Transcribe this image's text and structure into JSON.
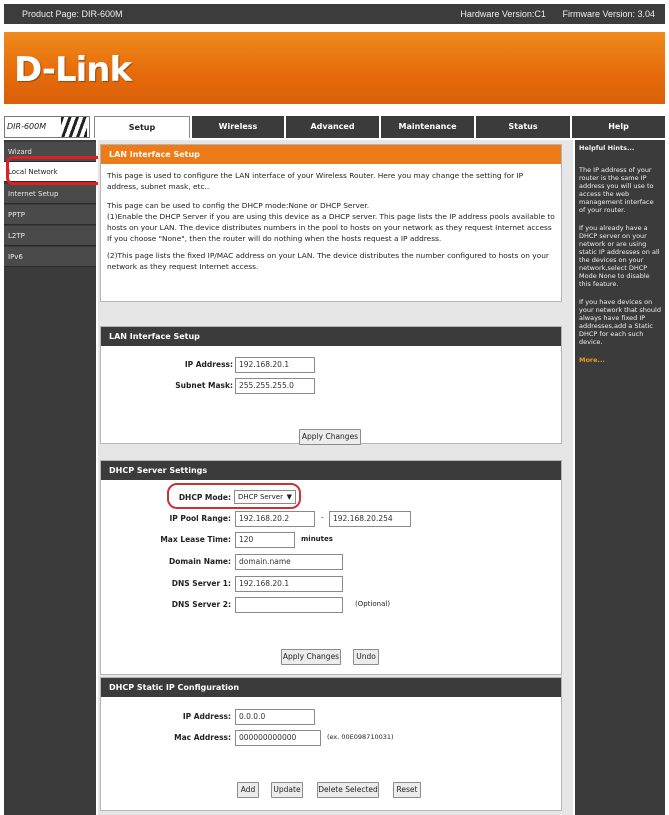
{
  "header": {
    "product_page": "Product Page: DIR-600M",
    "hardware_version": "Hardware Version:C1",
    "firmware_version": "Firmware Version: 3.04"
  },
  "brand": {
    "logo_text": "D-Link",
    "model_badge": "DIR-600M"
  },
  "nav": {
    "tabs": [
      "Setup",
      "Wireless",
      "Advanced",
      "Maintenance",
      "Status",
      "Help"
    ],
    "active_tab": "Setup"
  },
  "sidebar": {
    "items": [
      "Wizard",
      "Local Network",
      "Internet Setup",
      "PPTP",
      "L2TP",
      "IPv6"
    ],
    "active_item": "Local Network"
  },
  "help": {
    "title": "Helpful Hints...",
    "p1": "The IP address of your router is the same IP address you will use to access the web management interface of your router.",
    "p2": "If you already have a DHCP server on your network or are using static IP addresses on all the devices on your network,select DHCP Mode None to disable this feature.",
    "p3": "If you have devices on your network that should always have fixed IP addresses,add a Static DHCP for each such device.",
    "more": "More..."
  },
  "intro": {
    "title": "LAN Interface Setup",
    "p1": "This page is used to configure the LAN interface of your Wireless Router. Here you may change the setting for IP address, subnet mask, etc..",
    "p2": "This page can be used to config the DHCP mode:None or DHCP Server.",
    "p3": "(1)Enable the DHCP Server if you are using this device as a DHCP server. This page lists the IP address pools available to hosts on your LAN. The device distributes numbers in the pool to hosts on your network as they request Internet access If you choose \"None\", then the router will do nothing when the hosts request a IP address.",
    "p4": "(2)This page lists the fixed IP/MAC address on your LAN. The device distributes the number configured to hosts on your network as they request Internet access."
  },
  "lan": {
    "title": "LAN Interface Setup",
    "ip_label": "IP Address:",
    "ip_value": "192.168.20.1",
    "mask_label": "Subnet Mask:",
    "mask_value": "255.255.255.0",
    "apply_label": "Apply Changes"
  },
  "dhcp": {
    "title": "DHCP Server Settings",
    "mode_label": "DHCP Mode:",
    "mode_value": "DHCP Server",
    "pool_label": "IP Pool Range:",
    "pool_start": "192.168.20.2",
    "pool_sep": "-",
    "pool_end": "192.168.20.254",
    "lease_label": "Max Lease Time:",
    "lease_value": "120",
    "lease_unit": "minutes",
    "domain_label": "Domain Name:",
    "domain_value": "domain.name",
    "dns1_label": "DNS Server 1:",
    "dns1_value": "192.168.20.1",
    "dns2_label": "DNS Server 2:",
    "dns2_value": "",
    "dns2_hint": "(Optional)",
    "apply_label": "Apply Changes",
    "undo_label": "Undo"
  },
  "static": {
    "title": "DHCP Static IP Configuration",
    "ip_label": "IP Address:",
    "ip_value": "0.0.0.0",
    "mac_label": "Mac Address:",
    "mac_value": "000000000000",
    "mac_hint": "(ex. 00E098710031)",
    "add_label": "Add",
    "update_label": "Update",
    "delete_label": "Delete Selected",
    "reset_label": "Reset"
  },
  "colors": {
    "accent": "#ED7B18",
    "dark": "#3B3B3B",
    "highlight_ring": "#E02020"
  }
}
